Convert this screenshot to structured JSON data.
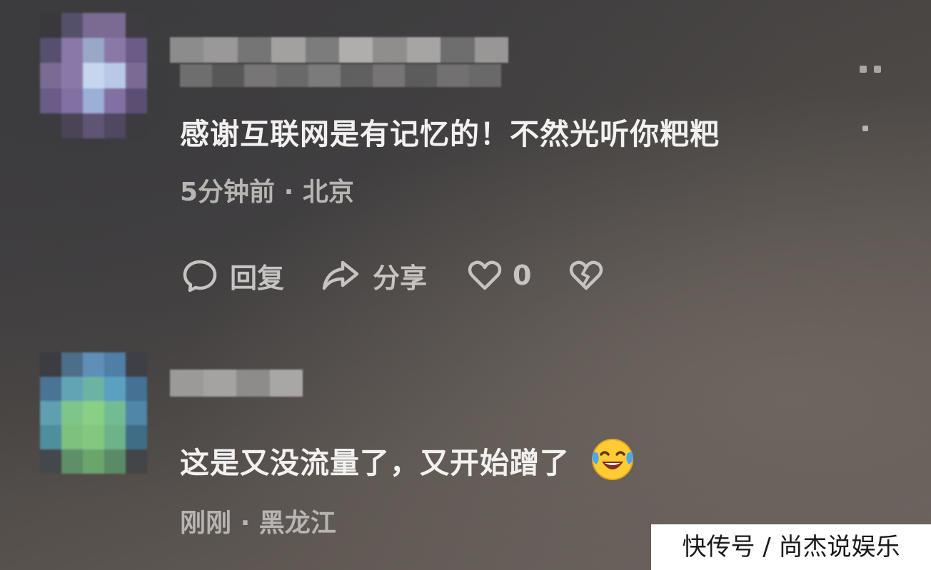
{
  "comments": [
    {
      "text": "感谢互联网是有记忆的！不然光听你粑粑",
      "time": "5分钟前",
      "location": "北京",
      "avatar_colors": [
        "#3a383c",
        "#55506a",
        "#7a6b93",
        "#7a6b93",
        "#3e3c40",
        "#574f6e",
        "#8a79a8",
        "#9aa8c8",
        "#8a79a8",
        "#6a5c86",
        "#7a6b93",
        "#8a79a8",
        "#c6d6ef",
        "#b8c8e6",
        "#7a6b93",
        "#6a5c86",
        "#8270a2",
        "#9bb0d6",
        "#8270a2",
        "#5a4f72",
        "#3d3b3f",
        "#4a4456",
        "#605473",
        "#4f4860",
        "#3d3b3f"
      ],
      "name_blur_colors": [
        "#8d8c8c",
        "#9a9898",
        "#767575",
        "#a3a1a0",
        "#7d7c7c",
        "#b0aeac",
        "#8f8e8d",
        "#a7a5a3",
        "#6f6e6e",
        "#999796"
      ]
    },
    {
      "text": "这是又没流量了，又开始蹭了",
      "time": "刚刚",
      "location": "黑龙江",
      "avatar_colors": [
        "#3b3d42",
        "#4d6e8a",
        "#5d8fb8",
        "#4f7ea6",
        "#3e4046",
        "#4a7494",
        "#62a3b4",
        "#6cb3a4",
        "#5aa0c0",
        "#457195",
        "#5f9fb0",
        "#7fc58a",
        "#89cf86",
        "#72bb93",
        "#4e87a7",
        "#4f8e9c",
        "#7ec07e",
        "#84c781",
        "#6eb28a",
        "#3f6d86",
        "#44474c",
        "#5e8f66",
        "#6aa56c",
        "#5b8a67",
        "#444547"
      ],
      "name_blur_colors": [
        "#9c9a98",
        "#a5a3a1",
        "#8e8c8b",
        "#a9a7a5"
      ]
    }
  ],
  "actions": {
    "reply_label": "回复",
    "share_label": "分享",
    "like_count": "0"
  },
  "watermark": "快传号 / 尚杰说娱乐",
  "colors": {
    "text": "#f2f1f0",
    "meta": "#b8b4b1",
    "icon": "#c7c3c0"
  }
}
